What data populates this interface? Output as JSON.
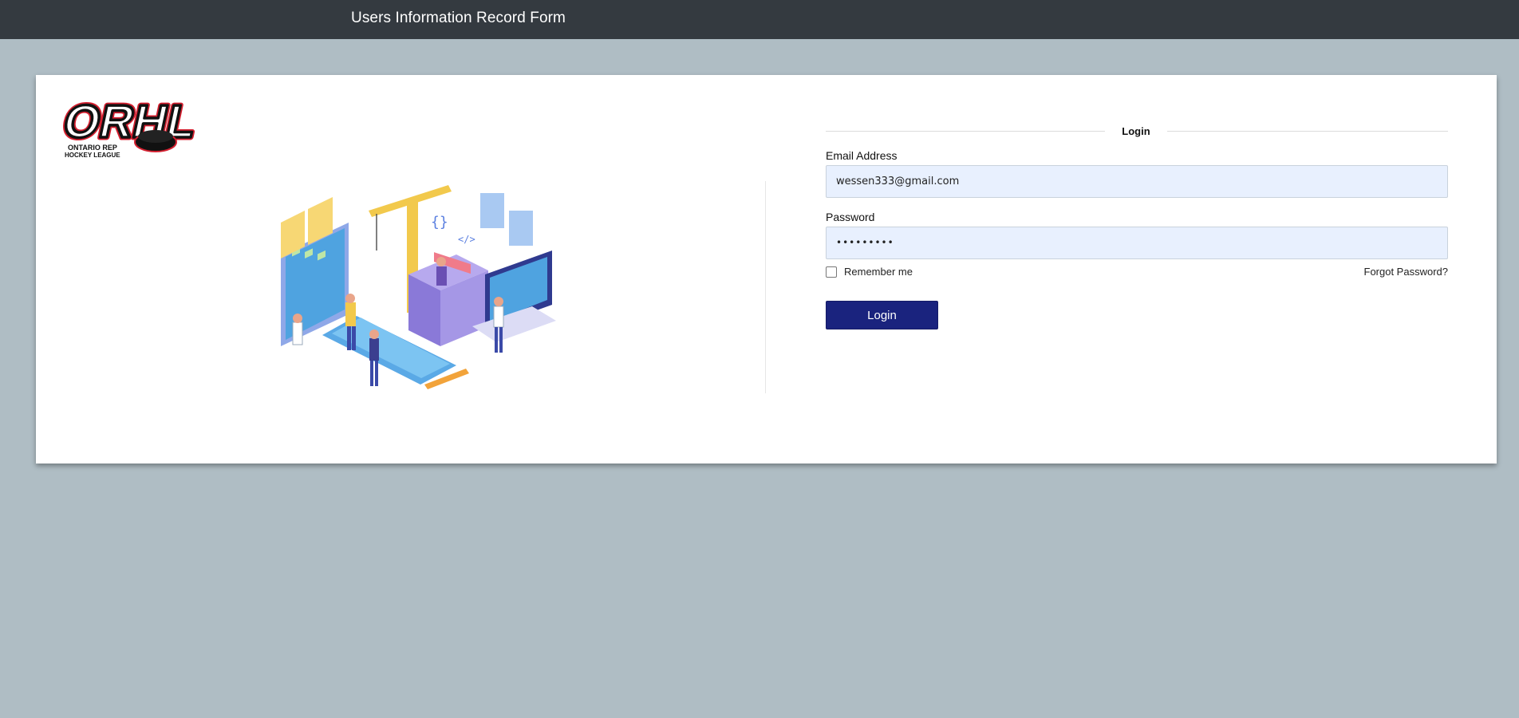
{
  "header": {
    "title": "Users Information Record Form"
  },
  "brand": {
    "logo_text": "ORHL",
    "logo_subtext_1": "ONTARIO REP",
    "logo_subtext_2": "HOCKEY LEAGUE"
  },
  "login_form": {
    "legend": "Login",
    "email": {
      "label": "Email Address",
      "value": "wessen333@gmail.com"
    },
    "password": {
      "label": "Password",
      "value": "•••••••••"
    },
    "remember_label": "Remember me",
    "remember_checked": false,
    "forgot_label": "Forgot Password?",
    "submit_label": "Login"
  },
  "colors": {
    "header_bg": "#343a40",
    "page_bg": "#afbdc4",
    "button_bg": "#1a237e",
    "input_bg": "#e8f0fe"
  }
}
